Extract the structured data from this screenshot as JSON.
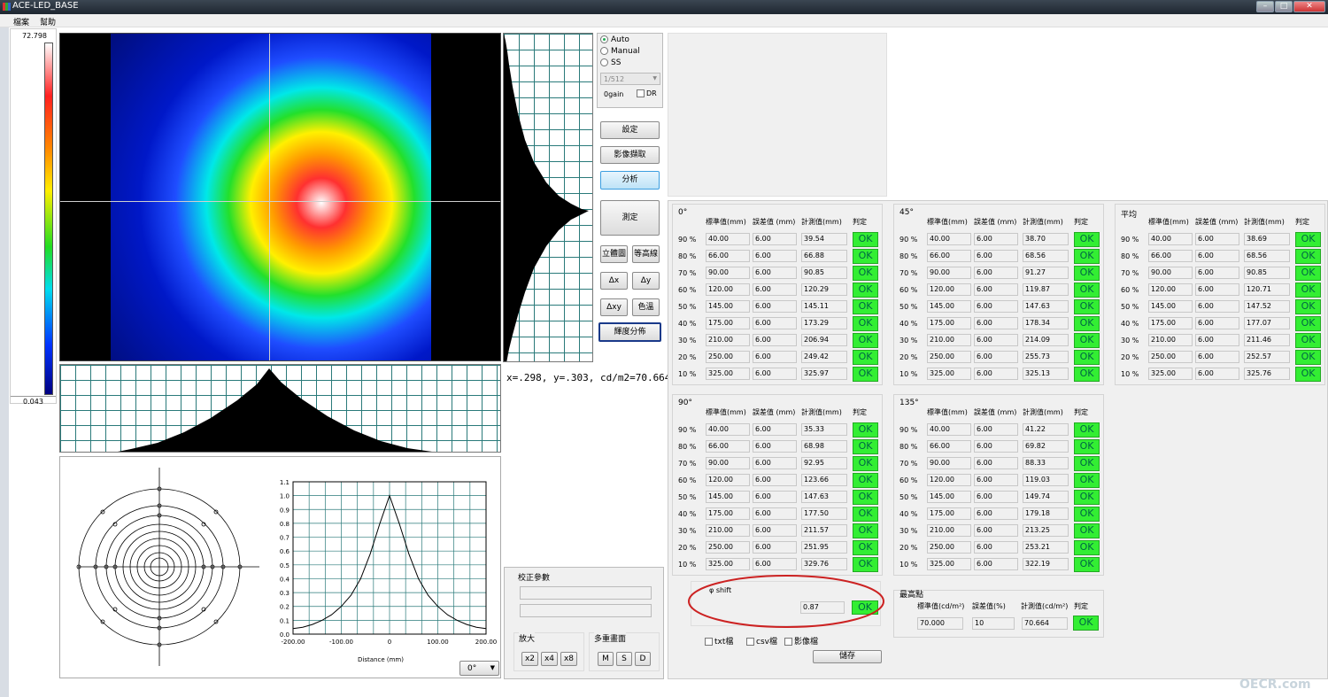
{
  "window": {
    "title": "ACE-LED_BASE"
  },
  "menu": [
    "檔案",
    "幫助"
  ],
  "colorbar": {
    "max": "72.798",
    "min": "0.043"
  },
  "readout": "x=.298, y=.303, cd/m2=70.664",
  "exposure": {
    "modes": [
      "Auto",
      "Manual",
      "SS"
    ],
    "selected": "Auto",
    "shutter": "1/512",
    "gain": "0gain",
    "dr_label": "DR"
  },
  "buttons": {
    "settings": "設定",
    "capture": "影像擷取",
    "analyze": "分析",
    "measure": "測定",
    "view3d": "立體圖",
    "contour": "等高線",
    "dx": "Δx",
    "dy": "Δy",
    "dxy": "Δxy",
    "color_temp": "色溫",
    "luminance": "輝度分佈",
    "save": "儲存"
  },
  "calibration": {
    "title": "校正參數",
    "zoom_title": "放大",
    "zoom": [
      "x2",
      "x4",
      "x8"
    ],
    "overlay_title": "多重畫面",
    "overlay": [
      "M",
      "S",
      "D"
    ]
  },
  "profile_chart": {
    "xlabel": "Distance (mm)",
    "x_ticks": [
      "-200.00",
      "-100.00",
      "0",
      "100.00",
      "200.00"
    ],
    "y_ticks": [
      "1.1",
      "1.0",
      "0.9",
      "0.8",
      "0.7",
      "0.6",
      "0.5",
      "0.4",
      "0.3",
      "0.2",
      "0.1",
      "0.0"
    ],
    "angle": "0°"
  },
  "chart_data": {
    "type": "line",
    "x": [
      -200,
      -180,
      -160,
      -140,
      -120,
      -100,
      -80,
      -60,
      -40,
      -20,
      0,
      20,
      40,
      60,
      80,
      100,
      120,
      140,
      160,
      180,
      200
    ],
    "series": [
      {
        "values": [
          0.04,
          0.05,
          0.07,
          0.1,
          0.14,
          0.2,
          0.28,
          0.4,
          0.58,
          0.8,
          1.0,
          0.8,
          0.58,
          0.4,
          0.28,
          0.2,
          0.14,
          0.1,
          0.07,
          0.05,
          0.04
        ]
      }
    ],
    "xlabel": "Distance (mm)",
    "ylim": [
      0,
      1.1
    ],
    "xlim": [
      -200,
      200
    ]
  },
  "table_headers": {
    "std": "標準值(mm)",
    "tol": "誤差值 (mm)",
    "meas": "計測值(mm)",
    "judge": "判定"
  },
  "groups": [
    {
      "title": "0°",
      "rows": [
        {
          "pct": "90 %",
          "std": "40.00",
          "tol": "6.00",
          "meas": "39.54",
          "res": "OK"
        },
        {
          "pct": "80 %",
          "std": "66.00",
          "tol": "6.00",
          "meas": "66.88",
          "res": "OK"
        },
        {
          "pct": "70 %",
          "std": "90.00",
          "tol": "6.00",
          "meas": "90.85",
          "res": "OK"
        },
        {
          "pct": "60 %",
          "std": "120.00",
          "tol": "6.00",
          "meas": "120.29",
          "res": "OK"
        },
        {
          "pct": "50 %",
          "std": "145.00",
          "tol": "6.00",
          "meas": "145.11",
          "res": "OK"
        },
        {
          "pct": "40 %",
          "std": "175.00",
          "tol": "6.00",
          "meas": "173.29",
          "res": "OK"
        },
        {
          "pct": "30 %",
          "std": "210.00",
          "tol": "6.00",
          "meas": "206.94",
          "res": "OK"
        },
        {
          "pct": "20 %",
          "std": "250.00",
          "tol": "6.00",
          "meas": "249.42",
          "res": "OK"
        },
        {
          "pct": "10 %",
          "std": "325.00",
          "tol": "6.00",
          "meas": "325.97",
          "res": "OK"
        }
      ]
    },
    {
      "title": "45°",
      "rows": [
        {
          "pct": "90 %",
          "std": "40.00",
          "tol": "6.00",
          "meas": "38.70",
          "res": "OK"
        },
        {
          "pct": "80 %",
          "std": "66.00",
          "tol": "6.00",
          "meas": "68.56",
          "res": "OK"
        },
        {
          "pct": "70 %",
          "std": "90.00",
          "tol": "6.00",
          "meas": "91.27",
          "res": "OK"
        },
        {
          "pct": "60 %",
          "std": "120.00",
          "tol": "6.00",
          "meas": "119.87",
          "res": "OK"
        },
        {
          "pct": "50 %",
          "std": "145.00",
          "tol": "6.00",
          "meas": "147.63",
          "res": "OK"
        },
        {
          "pct": "40 %",
          "std": "175.00",
          "tol": "6.00",
          "meas": "178.34",
          "res": "OK"
        },
        {
          "pct": "30 %",
          "std": "210.00",
          "tol": "6.00",
          "meas": "214.09",
          "res": "OK"
        },
        {
          "pct": "20 %",
          "std": "250.00",
          "tol": "6.00",
          "meas": "255.73",
          "res": "OK"
        },
        {
          "pct": "10 %",
          "std": "325.00",
          "tol": "6.00",
          "meas": "325.13",
          "res": "OK"
        }
      ]
    },
    {
      "title": "平均",
      "rows": [
        {
          "pct": "90 %",
          "std": "40.00",
          "tol": "6.00",
          "meas": "38.69",
          "res": "OK"
        },
        {
          "pct": "80 %",
          "std": "66.00",
          "tol": "6.00",
          "meas": "68.56",
          "res": "OK"
        },
        {
          "pct": "70 %",
          "std": "90.00",
          "tol": "6.00",
          "meas": "90.85",
          "res": "OK"
        },
        {
          "pct": "60 %",
          "std": "120.00",
          "tol": "6.00",
          "meas": "120.71",
          "res": "OK"
        },
        {
          "pct": "50 %",
          "std": "145.00",
          "tol": "6.00",
          "meas": "147.52",
          "res": "OK"
        },
        {
          "pct": "40 %",
          "std": "175.00",
          "tol": "6.00",
          "meas": "177.07",
          "res": "OK"
        },
        {
          "pct": "30 %",
          "std": "210.00",
          "tol": "6.00",
          "meas": "211.46",
          "res": "OK"
        },
        {
          "pct": "20 %",
          "std": "250.00",
          "tol": "6.00",
          "meas": "252.57",
          "res": "OK"
        },
        {
          "pct": "10 %",
          "std": "325.00",
          "tol": "6.00",
          "meas": "325.76",
          "res": "OK"
        }
      ]
    },
    {
      "title": "90°",
      "rows": [
        {
          "pct": "90 %",
          "std": "40.00",
          "tol": "6.00",
          "meas": "35.33",
          "res": "OK"
        },
        {
          "pct": "80 %",
          "std": "66.00",
          "tol": "6.00",
          "meas": "68.98",
          "res": "OK"
        },
        {
          "pct": "70 %",
          "std": "90.00",
          "tol": "6.00",
          "meas": "92.95",
          "res": "OK"
        },
        {
          "pct": "60 %",
          "std": "120.00",
          "tol": "6.00",
          "meas": "123.66",
          "res": "OK"
        },
        {
          "pct": "50 %",
          "std": "145.00",
          "tol": "6.00",
          "meas": "147.63",
          "res": "OK"
        },
        {
          "pct": "40 %",
          "std": "175.00",
          "tol": "6.00",
          "meas": "177.50",
          "res": "OK"
        },
        {
          "pct": "30 %",
          "std": "210.00",
          "tol": "6.00",
          "meas": "211.57",
          "res": "OK"
        },
        {
          "pct": "20 %",
          "std": "250.00",
          "tol": "6.00",
          "meas": "251.95",
          "res": "OK"
        },
        {
          "pct": "10 %",
          "std": "325.00",
          "tol": "6.00",
          "meas": "329.76",
          "res": "OK"
        }
      ]
    },
    {
      "title": "135°",
      "rows": [
        {
          "pct": "90 %",
          "std": "40.00",
          "tol": "6.00",
          "meas": "41.22",
          "res": "OK"
        },
        {
          "pct": "80 %",
          "std": "66.00",
          "tol": "6.00",
          "meas": "69.82",
          "res": "OK"
        },
        {
          "pct": "70 %",
          "std": "90.00",
          "tol": "6.00",
          "meas": "88.33",
          "res": "OK"
        },
        {
          "pct": "60 %",
          "std": "120.00",
          "tol": "6.00",
          "meas": "119.03",
          "res": "OK"
        },
        {
          "pct": "50 %",
          "std": "145.00",
          "tol": "6.00",
          "meas": "149.74",
          "res": "OK"
        },
        {
          "pct": "40 %",
          "std": "175.00",
          "tol": "6.00",
          "meas": "179.18",
          "res": "OK"
        },
        {
          "pct": "30 %",
          "std": "210.00",
          "tol": "6.00",
          "meas": "213.25",
          "res": "OK"
        },
        {
          "pct": "20 %",
          "std": "250.00",
          "tol": "6.00",
          "meas": "253.21",
          "res": "OK"
        },
        {
          "pct": "10 %",
          "std": "325.00",
          "tol": "6.00",
          "meas": "322.19",
          "res": "OK"
        }
      ]
    }
  ],
  "phi_shift": {
    "label": "φ shift",
    "value": "0.87",
    "res": "OK"
  },
  "peak": {
    "title": "最高點",
    "h_std": "標準值(cd/m²)",
    "h_tol": "誤差值(%)",
    "h_meas": "計測值(cd/m²)",
    "h_judge": "判定",
    "std": "70.000",
    "tol": "10",
    "meas": "70.664",
    "res": "OK"
  },
  "export": [
    "txt檔",
    "csv檔",
    "影像檔"
  ],
  "watermark": "OECR.com",
  "colors": {
    "ok_green": "#33ee33",
    "highlight_ellipse": "#cc2222"
  }
}
